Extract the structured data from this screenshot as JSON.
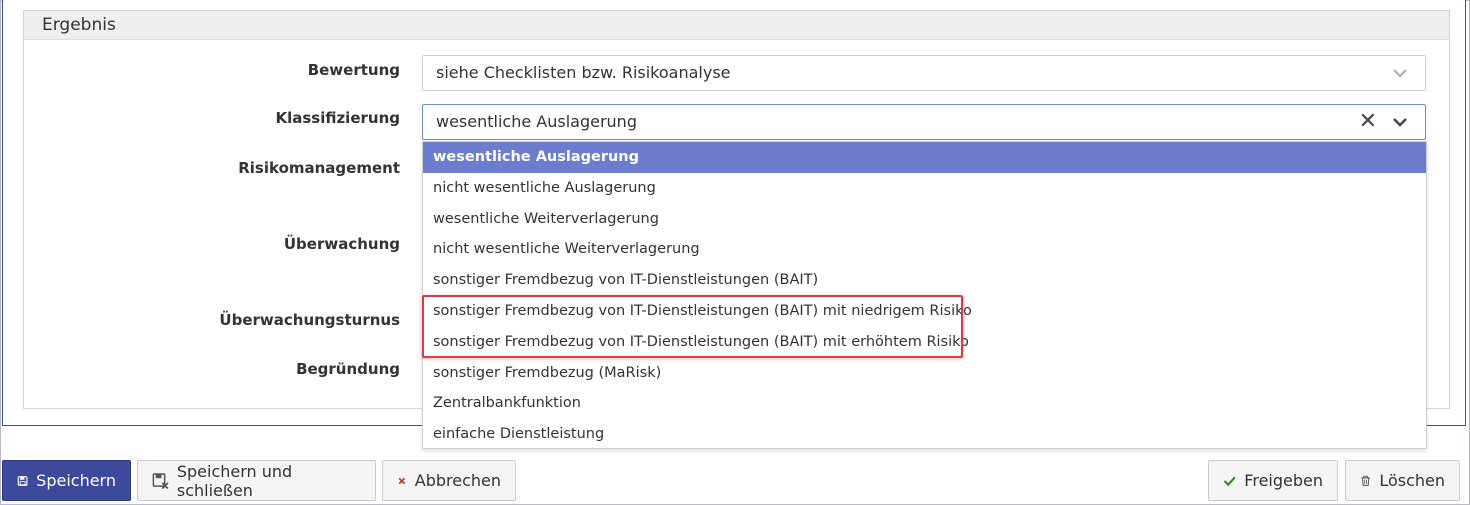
{
  "section": {
    "title": "Ergebnis"
  },
  "labels": {
    "bewertung": "Bewertung",
    "klassifizierung": "Klassifizierung",
    "risikomanagement": "Risikomanagement",
    "ueberwachung": "Überwachung",
    "ueberwachungsturnus": "Überwachungsturnus",
    "begruendung": "Begründung"
  },
  "bewertung": {
    "value": "siehe Checklisten bzw. Risikoanalyse"
  },
  "klassifizierung": {
    "value": "wesentliche Auslagerung",
    "clear_glyph": "✕",
    "options": [
      "wesentliche Auslagerung",
      "nicht wesentliche Auslagerung",
      "wesentliche Weiterverlagerung",
      "nicht wesentliche Weiterverlagerung",
      "sonstiger Fremdbezug von IT-Dienstleistungen (BAIT)",
      "sonstiger Fremdbezug von IT-Dienstleistungen (BAIT) mit niedrigem Risiko",
      "sonstiger Fremdbezug von IT-Dienstleistungen (BAIT) mit erhöhtem Risiko",
      "sonstiger Fremdbezug (MaRisk)",
      "Zentralbankfunktion",
      "einfache Dienstleistung"
    ]
  },
  "toolbar": {
    "save": "Speichern",
    "save_close": "Speichern und schließen",
    "cancel": "Abbrechen",
    "release": "Freigeben",
    "delete": "Löschen"
  },
  "icons": {
    "save": "floppy-disk-icon",
    "save_close": "floppy-disk-close-icon",
    "cancel": "x-mark-icon",
    "release": "checkmark-icon",
    "delete": "trash-icon",
    "chevron": "chevron-down-icon",
    "clear": "clear-x-icon"
  },
  "colors": {
    "primary": "#3d4a9c",
    "selected_option": "#6b7dcc",
    "highlight": "#e0393e",
    "cancel_icon": "#c0302b",
    "release_icon": "#2f8a2f"
  }
}
